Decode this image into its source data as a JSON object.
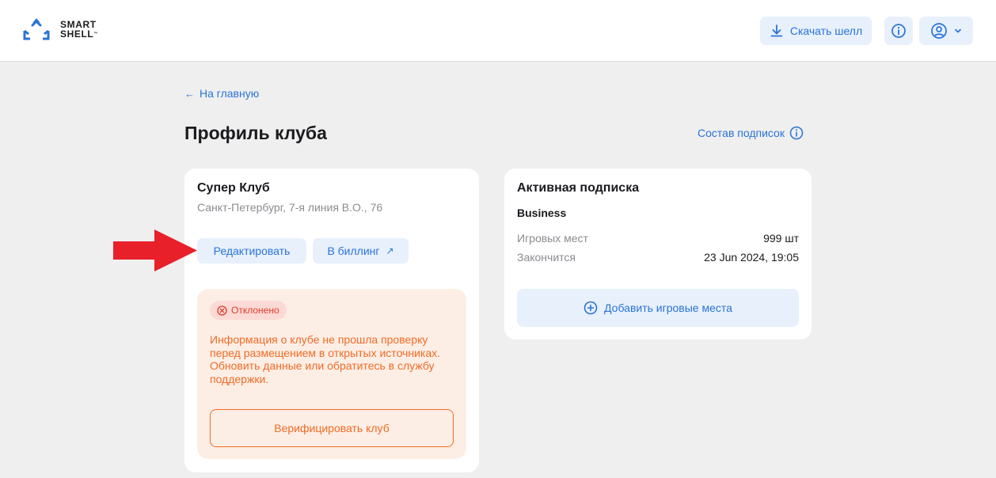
{
  "header": {
    "logo_line1": "SMART",
    "logo_line2": "SHELL",
    "logo_tm": "™",
    "download_label": "Скачать шелл",
    "download_icon": "download-icon",
    "info_icon": "info-icon",
    "user_icon": "user-icon",
    "chevron_icon": "chevron-down-icon"
  },
  "nav": {
    "back_arrow": "←",
    "back_label": "На главную"
  },
  "page": {
    "title": "Профиль клуба",
    "subscriptions_link": "Состав подписок"
  },
  "club": {
    "name": "Супер Клуб",
    "address": "Санкт-Петербург, 7-я линия В.О., 76",
    "edit_label": "Редактировать",
    "billing_label": "В биллинг",
    "billing_icon": "↗",
    "status_label": "Отклонено",
    "alert_text": "Информация о клубе не прошла проверку перед размещением в открытых источниках. Обновить данные или обратитесь в службу поддержки.",
    "verify_label": "Верифицировать клуб"
  },
  "subscription": {
    "title": "Активная подписка",
    "plan": "Business",
    "seats_label": "Игровых мест",
    "seats_value": "999 шт",
    "expires_label": "Закончится",
    "expires_value": "23 Jun 2024, 19:05",
    "add_label": "Добавить игровые места"
  },
  "colors": {
    "accent": "#2a74d8",
    "accent_bg": "#e7f0fb",
    "warning": "#f06b25",
    "warning_bg": "#fdeee5",
    "error": "#e13b2d",
    "annotation_arrow": "#e8202a"
  }
}
